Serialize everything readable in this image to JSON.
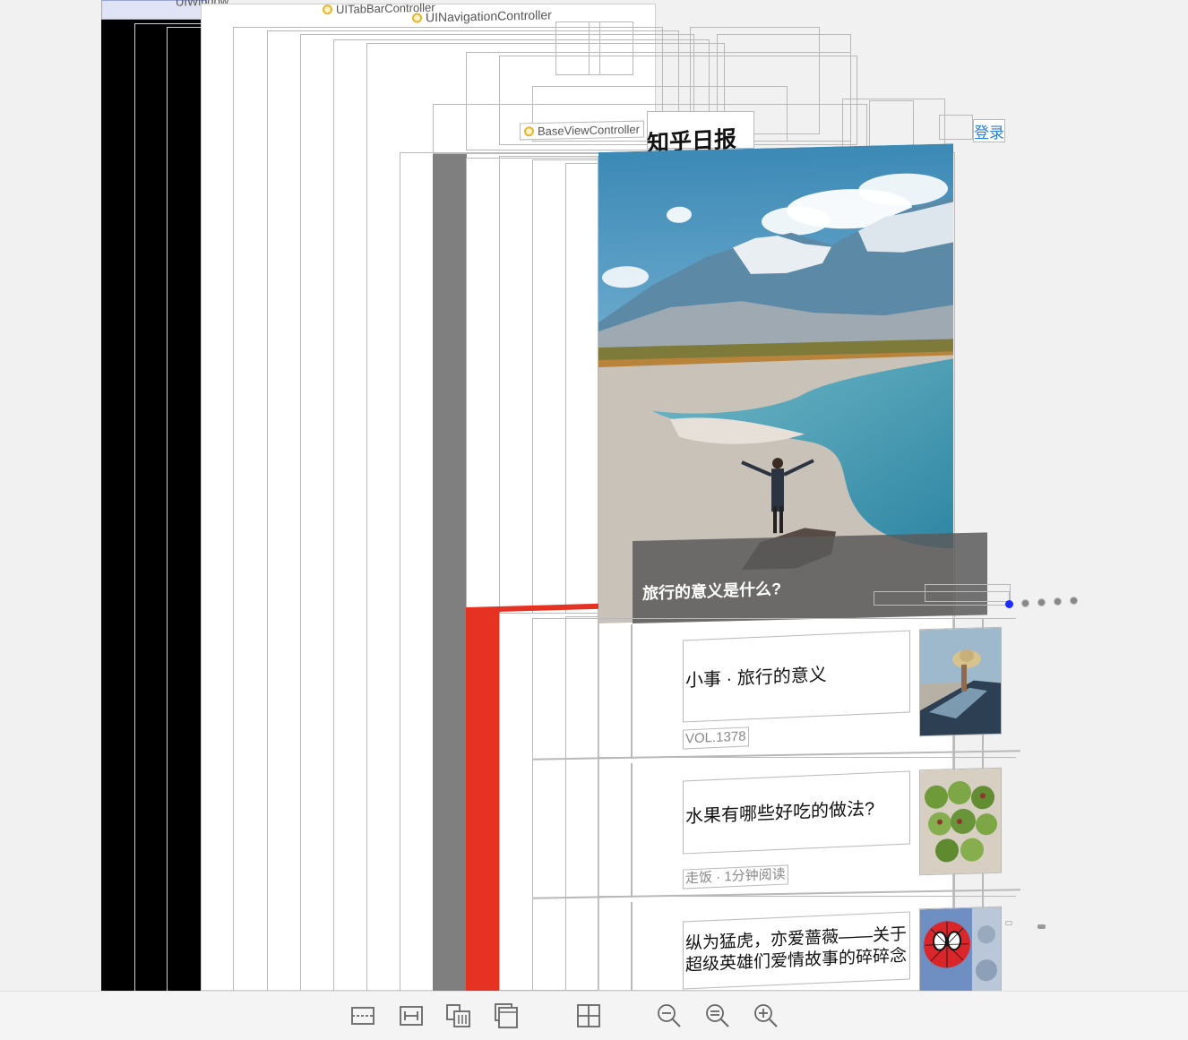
{
  "hierarchy_labels": {
    "window": "UIWindow",
    "tab_bar_controller": "UITabBarController",
    "navigation_controller": "UINavigationController",
    "base_view_controller": "BaseViewController"
  },
  "nav_bar": {
    "title": "知乎日报",
    "login_label": "登录"
  },
  "banner": {
    "caption": "旅行的意义是什么?",
    "page_count": 5,
    "current_page": 1
  },
  "stories": [
    {
      "title": "小事 · 旅行的意义",
      "meta": "VOL.1378",
      "thumb_icon": "car-window-hat-photo"
    },
    {
      "title": "水果有哪些好吃的做法?",
      "meta": "走饭 · 1分钟阅读",
      "thumb_icon": "green-fruit-photo"
    },
    {
      "title": "纵为猛虎，亦爱蔷薇——关于超级英雄们爱情故事的碎碎念",
      "meta": "",
      "thumb_icon": "spiderman-comic-photo"
    }
  ],
  "toolbar": {
    "buttons": [
      "clipping-icon",
      "width-icon",
      "layers-front-icon",
      "layers-back-icon",
      "grid-icon",
      "zoom-out-icon",
      "zoom-actual-icon",
      "zoom-in-icon"
    ]
  },
  "colors": {
    "background": "#f1f1f1",
    "frame_border": "#b9b9b9",
    "window_black": "#000000",
    "side_gray": "#7f7f7f",
    "accent_red": "#e63222",
    "login_blue": "#2a7fd6",
    "page_dot_active": "#1a2cff"
  }
}
